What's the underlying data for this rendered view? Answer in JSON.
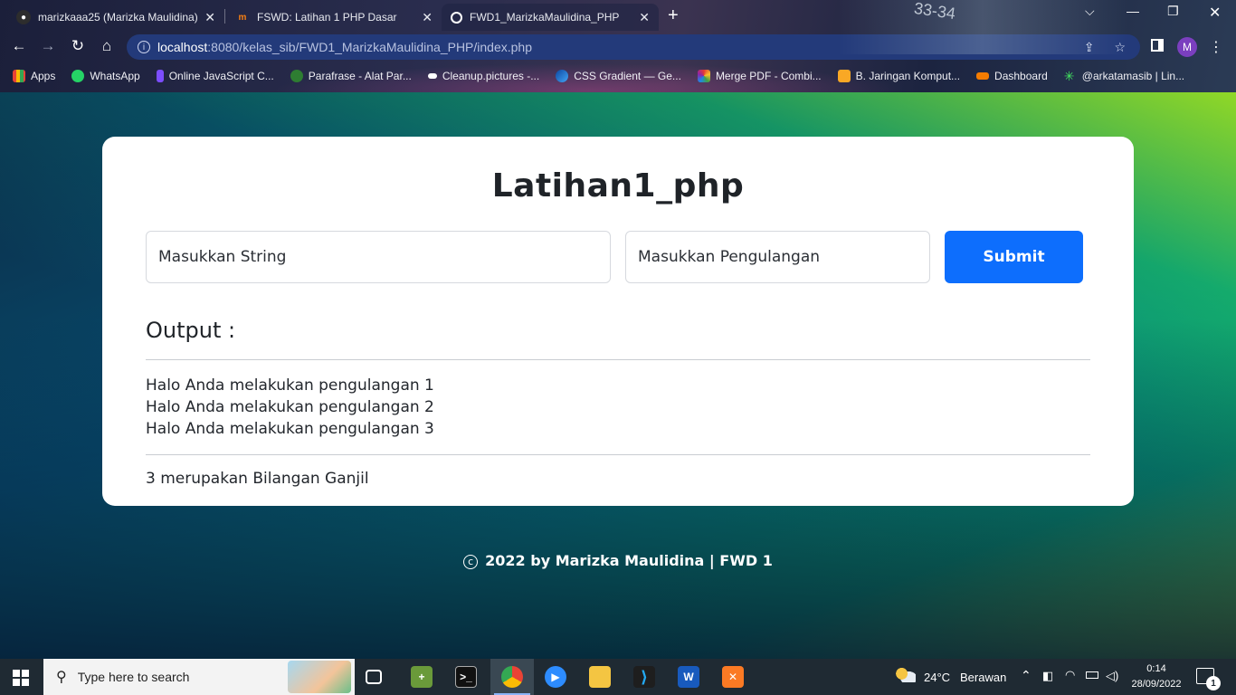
{
  "browser": {
    "tabs": [
      {
        "label": "marizkaaa25 (Marizka Maulidina)",
        "icon": "github-icon",
        "active": false
      },
      {
        "label": "FSWD: Latihan 1 PHP Dasar",
        "icon": "moodle-icon",
        "active": false
      },
      {
        "label": "FWD1_MarizkaMaulidina_PHP",
        "icon": "globe-icon",
        "active": true
      }
    ],
    "new_tab": "+",
    "url_host": "localhost",
    "url_path": ":8080/kelas_sib/FWD1_MarizkaMaulidina_PHP/index.php",
    "profile_initial": "M",
    "digits_bg": "33-34",
    "bookmarks": [
      {
        "label": "Apps",
        "icon": "apps-grid-icon",
        "color": "#f4b400"
      },
      {
        "label": "WhatsApp",
        "icon": "whatsapp-icon",
        "color": "#25d366"
      },
      {
        "label": "Online JavaScript C...",
        "icon": "compiler-icon",
        "color": "#7c4dff"
      },
      {
        "label": "Parafrase - Alat Par...",
        "icon": "paraphrase-icon",
        "color": "#2e7d32"
      },
      {
        "label": "Cleanup.pictures -...",
        "icon": "cleanup-icon",
        "color": "#ffffff"
      },
      {
        "label": "CSS Gradient — Ge...",
        "icon": "css-gradient-icon",
        "color": "#1e88e5"
      },
      {
        "label": "Merge PDF - Combi...",
        "icon": "merge-pdf-icon",
        "color": "#e53935"
      },
      {
        "label": "B. Jaringan Komput...",
        "icon": "doc-icon",
        "color": "#f9a825"
      },
      {
        "label": "Dashboard",
        "icon": "moodle-icon",
        "color": "#f57c00"
      },
      {
        "label": "@arkatamasib | Lin...",
        "icon": "linktree-icon",
        "color": "#43e660"
      }
    ]
  },
  "app": {
    "title": "Latihan1_php",
    "string_placeholder": "Masukkan String",
    "repeat_placeholder": "Masukkan Pengulangan",
    "submit_label": "Submit",
    "output_heading": "Output :",
    "output_lines": [
      "Halo Anda melakukan pengulangan 1",
      "Halo Anda melakukan pengulangan 2",
      "Halo Anda melakukan pengulangan 3"
    ],
    "result": "3 merupakan Bilangan Ganjil",
    "footer_symbol": "c",
    "footer": "2022 by Marizka Maulidina | FWD 1",
    "accent": "#0d6efd"
  },
  "taskbar": {
    "search_placeholder": "Type here to search",
    "weather_temp": "24°C",
    "weather_desc": "Berawan",
    "time": "0:14",
    "date": "28/09/2022",
    "notification_count": "1"
  }
}
